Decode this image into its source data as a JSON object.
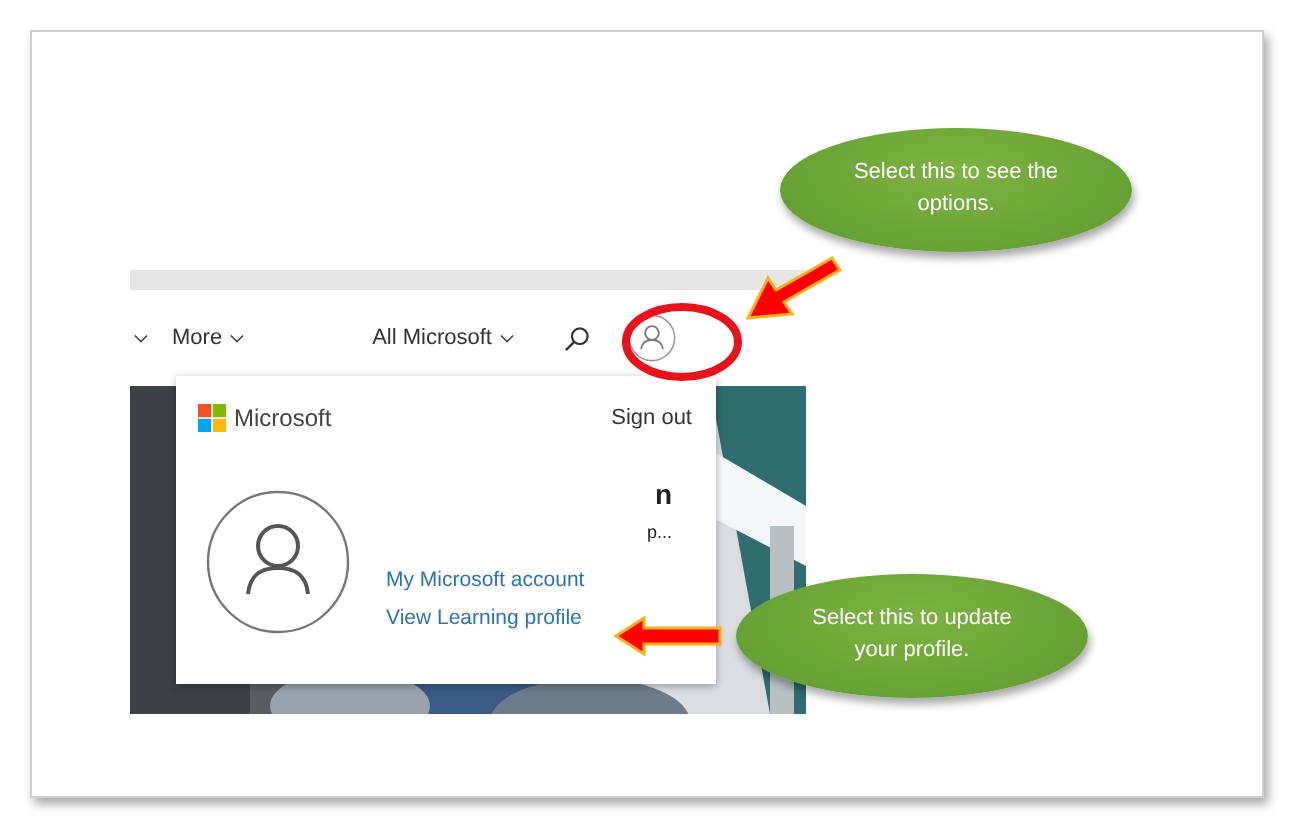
{
  "nav": {
    "items": [
      {
        "label": "More"
      },
      {
        "label": "All Microsoft"
      }
    ]
  },
  "account_panel": {
    "brand": "Microsoft",
    "sign_out": "Sign out",
    "name_fragment": "n",
    "detail_fragment": "p...",
    "links": [
      "My Microsoft account",
      "View Learning profile"
    ]
  },
  "callouts": [
    {
      "text": "Select this to see the options."
    },
    {
      "text": "Select this to update your profile."
    }
  ]
}
